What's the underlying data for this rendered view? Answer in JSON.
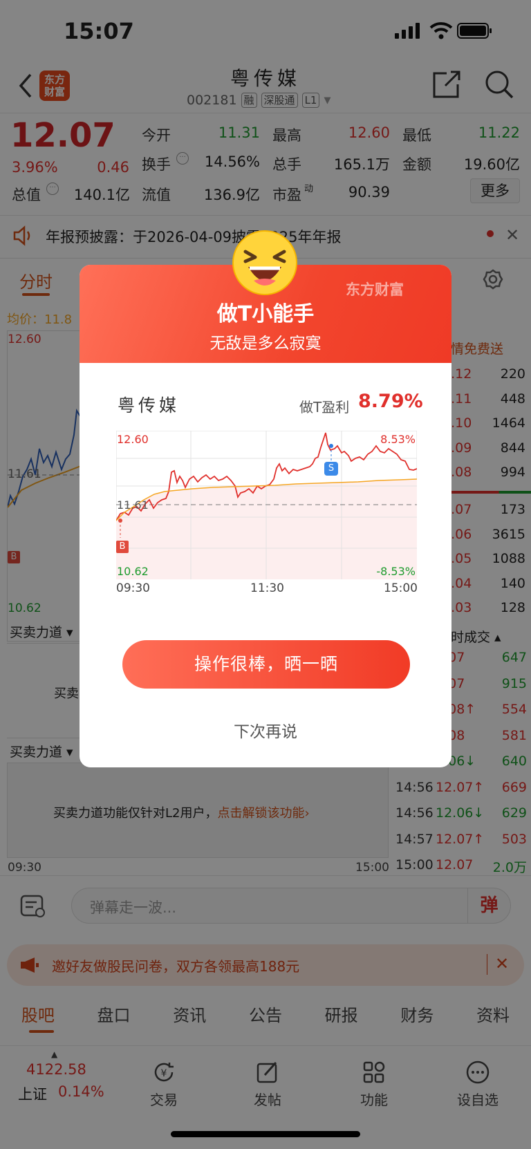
{
  "status_bar": {
    "time": "15:07"
  },
  "header": {
    "logo_text": "东方\n财富",
    "title": "粤传媒",
    "code": "002181",
    "tags": [
      "融",
      "深股通",
      "L1"
    ]
  },
  "quote": {
    "price": "12.07",
    "change_pct": "3.96%",
    "change": "0.46",
    "rows": [
      [
        {
          "label": "今开",
          "value": "11.31",
          "color": "green"
        },
        {
          "label": "最高",
          "value": "12.60",
          "color": "red"
        },
        {
          "label": "最低",
          "value": "11.22",
          "color": "green"
        }
      ],
      [
        {
          "label": "换手",
          "value": "14.56%",
          "color": "black"
        },
        {
          "label": "总手",
          "value": "165.1万",
          "color": "black"
        },
        {
          "label": "金额",
          "value": "19.60亿",
          "color": "black"
        }
      ]
    ],
    "row3": {
      "total_value_label": "总值",
      "total_value": "140.1亿",
      "float_label": "流值",
      "float_value": "136.9亿",
      "pe_label": "市盈",
      "pe_sup": "动",
      "pe_value": "90.39",
      "more": "更多"
    }
  },
  "notice": {
    "text": "年报预披露：于2026-04-09披露2025年年报"
  },
  "chart_tabs": {
    "active": "分时"
  },
  "left_chart": {
    "avg_label": "均价：11.8",
    "top_price": "12.60",
    "mid_price": "11.61",
    "low_price": "10.62",
    "buy_marker": "B",
    "time_start": "09:30",
    "time_end": "15:00",
    "force_title": "买卖力道",
    "force_short": "买卖",
    "force_msg": "买卖力道功能仅针对L2用户，",
    "force_link": "点击解锁该功能"
  },
  "right_panel": {
    "header": "情免费送",
    "asks": [
      [
        "2.12",
        "220"
      ],
      [
        "2.11",
        "448"
      ],
      [
        "2.10",
        "1464"
      ],
      [
        "2.09",
        "844"
      ],
      [
        "2.08",
        "994"
      ]
    ],
    "bids": [
      [
        "2.07",
        "173"
      ],
      [
        "2.06",
        "3615"
      ],
      [
        "2.05",
        "1088"
      ],
      [
        "2.04",
        "140"
      ],
      [
        "2.03",
        "128"
      ]
    ],
    "trades_header": "时成交",
    "trades": [
      {
        "time": "",
        "price": "2.07",
        "vol": "647",
        "color": "green"
      },
      {
        "time": "",
        "price": "2.07",
        "vol": "915",
        "color": "green"
      },
      {
        "time": "",
        "price": "2.08↑",
        "vol": "554",
        "color": "red"
      },
      {
        "time": "",
        "price": "2.08",
        "vol": "581",
        "color": "red"
      },
      {
        "time": "",
        "price": "2.06↓",
        "vol": "640",
        "color": "green"
      },
      {
        "time": "14:56",
        "price": "12.07↑",
        "vol": "669",
        "color": "red"
      },
      {
        "time": "14:56",
        "price": "12.06↓",
        "vol": "629",
        "color": "green"
      },
      {
        "time": "14:57",
        "price": "12.07↑",
        "vol": "503",
        "color": "red"
      },
      {
        "time": "15:00",
        "price": "12.07",
        "vol": "2.0万",
        "color": "green"
      }
    ]
  },
  "comment_bar": {
    "placeholder": "弹幕走一波...",
    "danmu": "弹"
  },
  "banner": {
    "text": "邀好友做股民问卷，双方各领最高188元"
  },
  "nav_tabs": [
    "股吧",
    "盘口",
    "资讯",
    "公告",
    "研报",
    "财务",
    "资料"
  ],
  "bottom_bar": {
    "index_value": "4122.58",
    "index_name": "上证",
    "index_pct": "0.14%",
    "items": [
      "交易",
      "发帖",
      "功能",
      "设自选"
    ]
  },
  "modal": {
    "title": "做T小能手",
    "subtitle": "无敌是多么寂寞",
    "brand": "东方财富",
    "stock_name": "粤传媒",
    "profit_label": "做T盈利",
    "profit_value": "8.79%",
    "chart": {
      "price_high": "12.60",
      "price_mid": "11.61",
      "price_low": "10.62",
      "pct_high": "8.53%",
      "pct_low": "-8.53%",
      "time_start": "09:30",
      "time_mid": "11:30",
      "time_end": "15:00",
      "buy_marker": "B",
      "sell_marker": "S"
    },
    "share_button": "操作很棒，晒一晒",
    "later_button": "下次再说"
  },
  "colors": {
    "up": "#e0302c",
    "down": "#1e9b2e",
    "accent": "#f13b26",
    "avg_line": "#f5a623"
  }
}
